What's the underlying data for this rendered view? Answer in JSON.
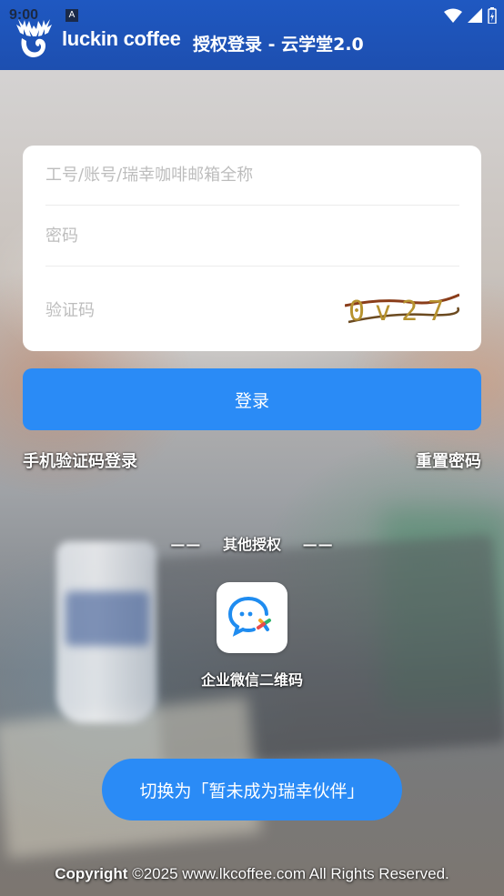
{
  "status_bar": {
    "time": "9:00",
    "notification_badge": "A",
    "icons": [
      "wifi-icon",
      "signal-icon",
      "battery-icon"
    ]
  },
  "header": {
    "brand": "luckin coffee",
    "title": "授权登录 - 云学堂2.0",
    "logo_icon": "deer-logo-icon"
  },
  "login_form": {
    "account_placeholder": "工号/账号/瑞幸咖啡邮箱全称",
    "password_placeholder": "密码",
    "captcha_placeholder": "验证码",
    "captcha_text": "0v27",
    "submit_label": "登录"
  },
  "links": {
    "sms_login": "手机验证码登录",
    "reset_password": "重置密码"
  },
  "other_auth": {
    "dash_left": "——",
    "title": "其他授权",
    "dash_right": "——",
    "wecom_label": "企业微信二维码",
    "wecom_icon": "wecom-icon"
  },
  "switch_button_label": "切换为「暂未成为瑞幸伙伴」",
  "footer": {
    "copyright_bold": "Copyright",
    "copyright_rest": " ©2025 www.lkcoffee.com All Rights Reserved."
  },
  "colors": {
    "header_blue": "#1f58c1",
    "button_blue": "#2a8bf6",
    "card_white": "#ffffff"
  }
}
